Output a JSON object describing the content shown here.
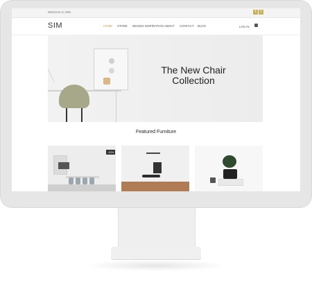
{
  "topbar": {
    "welcome": "Welcome to SIM",
    "social_fb": "f",
    "social_tw": "t"
  },
  "header": {
    "logo": "SIM",
    "menu": [
      "HOME",
      "STORE",
      "DESIGN INSPIRATION",
      "ABOUT",
      "CONTACT",
      "BLOG"
    ],
    "login": "LOG IN"
  },
  "hero": {
    "title_line1": "The New Chair",
    "title_line2": "Collection"
  },
  "featured": {
    "title": "Featured Furniture",
    "badge": "-20%"
  }
}
